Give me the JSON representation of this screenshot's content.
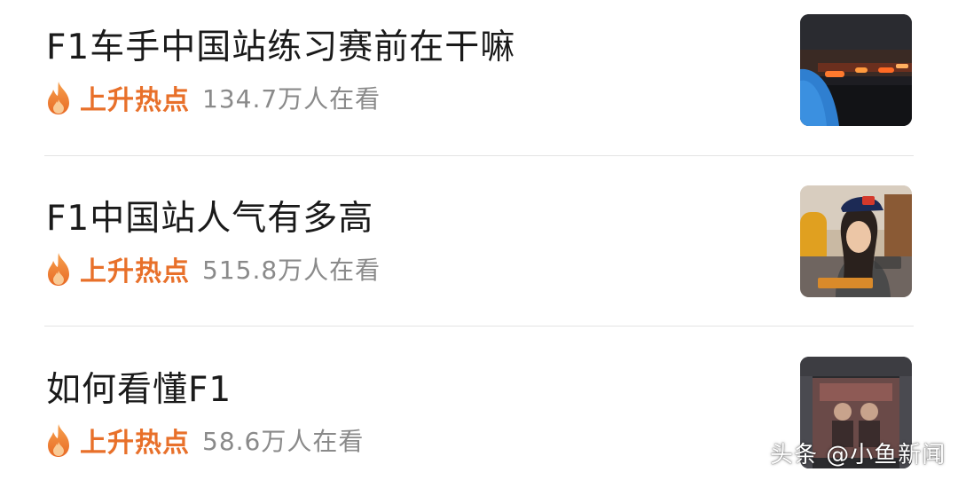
{
  "hot_list": {
    "items": [
      {
        "title": "F1车手中国站练习赛前在干嘛",
        "badge": "上升热点",
        "views": "134.7万人在看",
        "thumb_icon": "racetrack-night-thumbnail"
      },
      {
        "title": "F1中国站人气有多高",
        "badge": "上升热点",
        "views": "515.8万人在看",
        "thumb_icon": "fan-interview-thumbnail"
      },
      {
        "title": "如何看懂F1",
        "badge": "上升热点",
        "views": "58.6万人在看",
        "thumb_icon": "stage-event-thumbnail"
      }
    ]
  },
  "watermark": {
    "text": "头条 @小鱼新闻"
  },
  "colors": {
    "badge": "#e8702a",
    "title": "#1a1a1a",
    "views": "#8a8a8a",
    "divider": "#e4e4e4"
  }
}
